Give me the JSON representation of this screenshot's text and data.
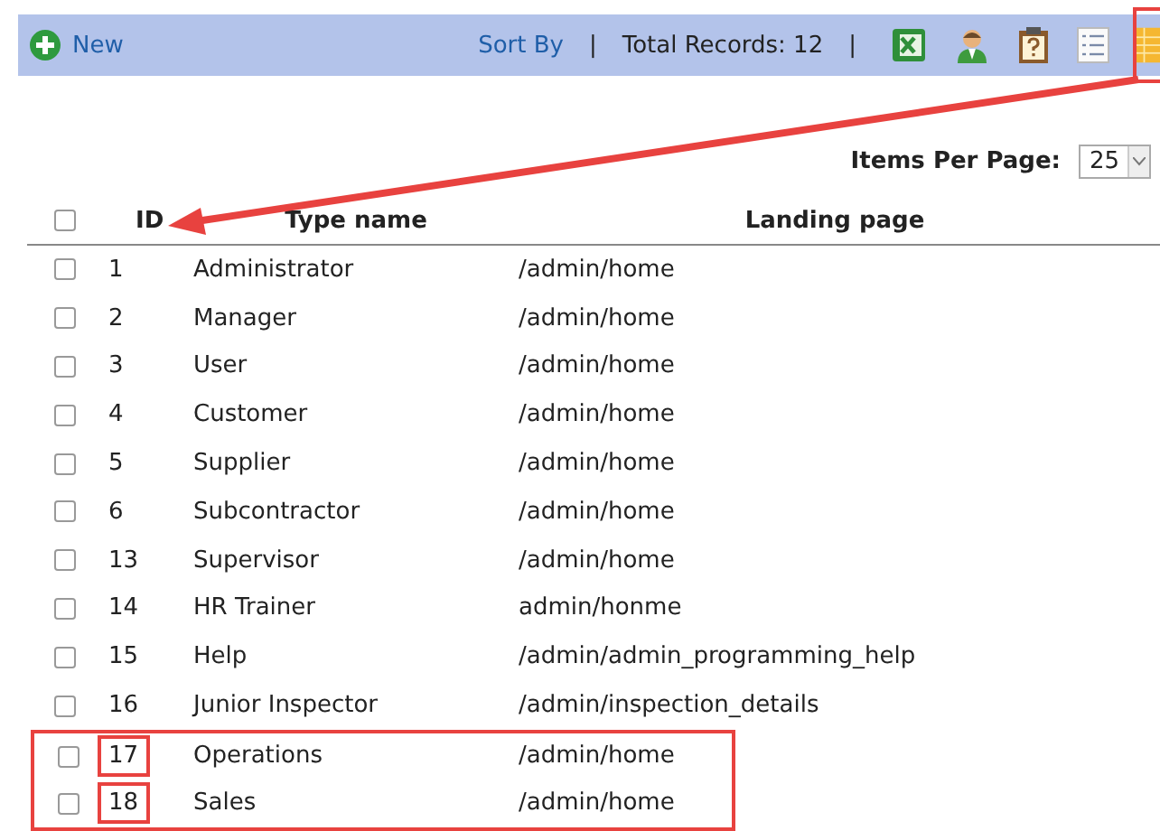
{
  "toolbar": {
    "new_label": "New",
    "sort_by": "Sort By",
    "separator": "|",
    "total_records": "Total Records: 12"
  },
  "pager": {
    "label": "Items Per Page:",
    "value": "25"
  },
  "table": {
    "columns": [
      "ID",
      "Type name",
      "Landing page"
    ],
    "all_checked": false,
    "rows": [
      {
        "id": "1",
        "type_name": "Administrator",
        "landing_page": "/admin/home",
        "checked": false,
        "highlighted": false
      },
      {
        "id": "2",
        "type_name": "Manager",
        "landing_page": "/admin/home",
        "checked": false,
        "highlighted": false
      },
      {
        "id": "3",
        "type_name": "User",
        "landing_page": "/admin/home",
        "checked": false,
        "highlighted": false
      },
      {
        "id": "4",
        "type_name": "Customer",
        "landing_page": "/admin/home",
        "checked": false,
        "highlighted": false
      },
      {
        "id": "5",
        "type_name": "Supplier",
        "landing_page": "/admin/home",
        "checked": false,
        "highlighted": false
      },
      {
        "id": "6",
        "type_name": "Subcontractor",
        "landing_page": "/admin/home",
        "checked": false,
        "highlighted": false
      },
      {
        "id": "13",
        "type_name": "Supervisor",
        "landing_page": "/admin/home",
        "checked": false,
        "highlighted": false
      },
      {
        "id": "14",
        "type_name": "HR Trainer",
        "landing_page": "admin/honme",
        "checked": false,
        "highlighted": false
      },
      {
        "id": "15",
        "type_name": "Help",
        "landing_page": "/admin/admin_programming_help",
        "checked": false,
        "highlighted": false
      },
      {
        "id": "16",
        "type_name": "Junior Inspector",
        "landing_page": "/admin/inspection_details",
        "checked": false,
        "highlighted": false
      },
      {
        "id": "17",
        "type_name": "Operations",
        "landing_page": "/admin/home",
        "checked": false,
        "highlighted": true
      },
      {
        "id": "18",
        "type_name": "Sales",
        "landing_page": "/admin/home",
        "checked": false,
        "highlighted": true
      }
    ]
  }
}
